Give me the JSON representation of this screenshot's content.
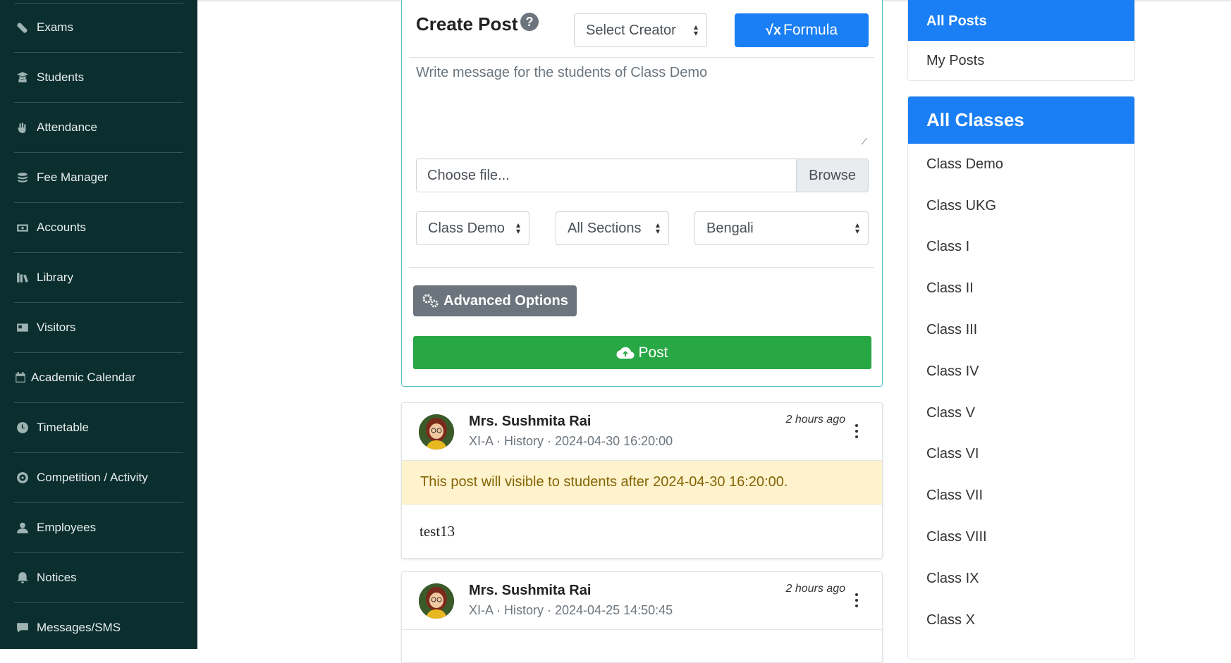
{
  "sidebar": {
    "items": [
      {
        "label": "Exams",
        "icon": "exams-icon"
      },
      {
        "label": "Students",
        "icon": "students-icon"
      },
      {
        "label": "Attendance",
        "icon": "attendance-icon"
      },
      {
        "label": "Fee Manager",
        "icon": "fee-manager-icon"
      },
      {
        "label": "Accounts",
        "icon": "accounts-icon"
      },
      {
        "label": "Library",
        "icon": "library-icon"
      },
      {
        "label": "Visitors",
        "icon": "visitors-icon"
      },
      {
        "label": "Academic Calendar",
        "icon": "calendar-icon"
      },
      {
        "label": "Timetable",
        "icon": "clock-icon"
      },
      {
        "label": "Competition / Activity",
        "icon": "competition-icon"
      },
      {
        "label": "Employees",
        "icon": "user-icon"
      },
      {
        "label": "Notices",
        "icon": "bell-icon"
      },
      {
        "label": "Messages/SMS",
        "icon": "message-icon"
      }
    ]
  },
  "create_post": {
    "title": "Create Post",
    "help": "?",
    "creator_select": "Select Creator",
    "formula_symbol": "√x",
    "formula_label": "Formula",
    "message_placeholder": "Write message for the students of Class Demo",
    "file_label": "Choose file...",
    "browse_label": "Browse",
    "class_select": "Class Demo",
    "section_select": "All Sections",
    "language_select": "Bengali",
    "advanced_label": "Advanced Options",
    "post_label": "Post"
  },
  "posts": [
    {
      "author": "Mrs. Sushmita Rai",
      "meta": "XI-A · History · 2024-04-30 16:20:00",
      "time": "2 hours ago",
      "alert": "This post will visible to students after 2024-04-30 16:20:00.",
      "body": "test13"
    },
    {
      "author": "Mrs. Sushmita Rai",
      "meta": "XI-A · History · 2024-04-25 14:50:45",
      "time": "2 hours ago"
    }
  ],
  "post_filters": {
    "all_posts": "All Posts",
    "my_posts": "My Posts"
  },
  "classes": {
    "title": "All Classes",
    "items": [
      "Class Demo",
      "Class UKG",
      "Class I",
      "Class II",
      "Class III",
      "Class IV",
      "Class V",
      "Class VI",
      "Class VII",
      "Class VIII",
      "Class IX",
      "Class X"
    ]
  },
  "colors": {
    "sidebar_bg": "#0b2e2e",
    "primary": "#1a7ff5",
    "success": "#28a745",
    "secondary": "#6c757d",
    "alert_bg": "#fff3cd"
  }
}
